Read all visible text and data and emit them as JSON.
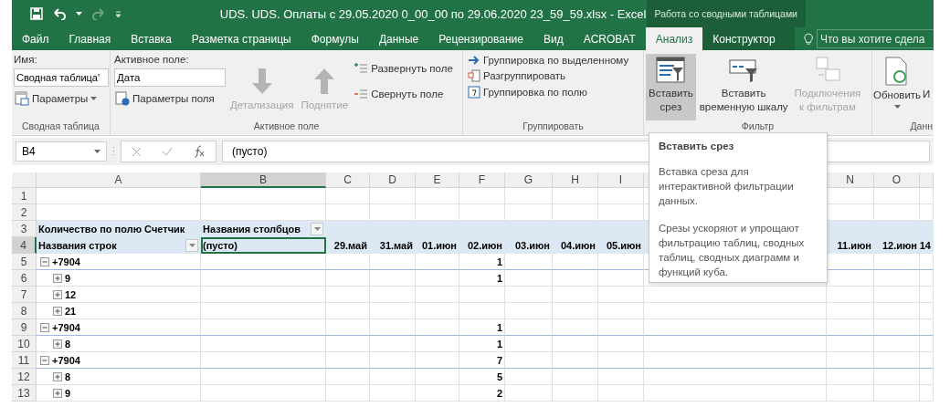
{
  "window": {
    "title": "UDS. UDS. Оплаты с 29.05.2020 0_00_00 по 29.06.2020 23_59_59.xlsx - Excel",
    "context_label": "Работа со сводными таблицами"
  },
  "tabs": [
    {
      "label": "Файл",
      "selected": false,
      "contextual": false
    },
    {
      "label": "Главная",
      "selected": false,
      "contextual": false
    },
    {
      "label": "Вставка",
      "selected": false,
      "contextual": false
    },
    {
      "label": "Разметка страницы",
      "selected": false,
      "contextual": false
    },
    {
      "label": "Формулы",
      "selected": false,
      "contextual": false
    },
    {
      "label": "Данные",
      "selected": false,
      "contextual": false
    },
    {
      "label": "Рецензирование",
      "selected": false,
      "contextual": false
    },
    {
      "label": "Вид",
      "selected": false,
      "contextual": false
    },
    {
      "label": "ACROBAT",
      "selected": false,
      "contextual": false
    },
    {
      "label": "Анализ",
      "selected": true,
      "contextual": true
    },
    {
      "label": "Конструктор",
      "selected": false,
      "contextual": true
    }
  ],
  "tell_me": {
    "placeholder": "Что вы хотите сдела"
  },
  "ribbon": {
    "pivot_table": {
      "name_label": "Имя:",
      "name_value": "Сводная таблица'",
      "options": "Параметры",
      "caption": "Сводная таблица"
    },
    "active_field": {
      "label": "Активное поле:",
      "value": "Дата",
      "settings": "Параметры поля",
      "drill_down": {
        "label": "Детализация",
        "disabled": true
      },
      "drill_up": {
        "label": "Поднятие",
        "disabled": true
      },
      "expand": "Развернуть поле",
      "collapse": "Свернуть поле",
      "caption": "Активное поле"
    },
    "group": {
      "items": [
        "Группировка по выделенному",
        "Разгруппировать",
        "Группировка по полю"
      ],
      "caption": "Группировать"
    },
    "filter": {
      "buttons": [
        {
          "label": "Вставить\nсрез",
          "pressed": true,
          "disabled": false
        },
        {
          "label": "Вставить\nвременную шкалу",
          "pressed": false,
          "disabled": false
        },
        {
          "label": "Подключения\nк фильтрам",
          "pressed": false,
          "disabled": true
        }
      ],
      "caption": "Фильтр"
    },
    "data": {
      "refresh": "Обновить",
      "next": "И",
      "caption": "Данн"
    }
  },
  "formula_bar": {
    "name_box": "B4",
    "value": "(пусто)"
  },
  "sheet": {
    "columns": [
      {
        "letter": "A",
        "selected": false
      },
      {
        "letter": "B",
        "selected": true
      },
      {
        "letter": "C",
        "selected": false
      },
      {
        "letter": "D",
        "selected": false
      },
      {
        "letter": "E",
        "selected": false
      },
      {
        "letter": "F",
        "selected": false
      },
      {
        "letter": "G",
        "selected": false
      },
      {
        "letter": "H",
        "selected": false
      },
      {
        "letter": "I",
        "selected": false
      },
      {
        "kind": "covered"
      },
      {
        "letter": "N",
        "selected": false
      },
      {
        "letter": "O",
        "selected": false
      }
    ],
    "rows": [
      {
        "number": "1",
        "selected": false
      },
      {
        "number": "2",
        "selected": false
      },
      {
        "number": "3",
        "selected": false
      },
      {
        "number": "4",
        "selected": true
      },
      {
        "number": "5",
        "selected": false
      },
      {
        "number": "6",
        "selected": false
      },
      {
        "number": "7",
        "selected": false
      },
      {
        "number": "8",
        "selected": false
      },
      {
        "number": "9",
        "selected": false
      },
      {
        "number": "10",
        "selected": false
      },
      {
        "number": "11",
        "selected": false
      },
      {
        "number": "12",
        "selected": false
      },
      {
        "number": "13",
        "selected": false
      }
    ],
    "pivot": {
      "value_field": "Количество по полю Счетчик",
      "column_labels": "Названия столбцов",
      "row_labels": "Названия строк",
      "column_items": [
        "(пусто)",
        "29.май",
        "31.май",
        "01.июн",
        "02.июн",
        "03.июн",
        "04.июн",
        "05.июн",
        "11.июн",
        "12.июн",
        "14"
      ],
      "groups": [
        {
          "label": "+7904",
          "expanded": true,
          "value": "1",
          "children": [
            {
              "label": "9",
              "expanded": false,
              "value": "1"
            },
            {
              "label": "12",
              "expanded": false
            },
            {
              "label": "21",
              "expanded": false
            }
          ]
        },
        {
          "label": "+7904",
          "expanded": true,
          "value": "1",
          "children": [
            {
              "label": "8",
              "expanded": false,
              "value": "1"
            }
          ]
        },
        {
          "label": "+7904",
          "expanded": true,
          "value": "7",
          "children": [
            {
              "label": "8",
              "expanded": false,
              "value": "5"
            },
            {
              "label": "9",
              "expanded": false,
              "value": "2"
            }
          ]
        }
      ]
    }
  },
  "tooltip": {
    "title": "Вставить срез",
    "paragraphs": [
      "Вставка среза для интерактивной фильтрации данных.",
      "Срезы ускоряют и упрощают фильтрацию таблиц, сводных таблиц, сводных диаграмм и функций куба."
    ]
  }
}
